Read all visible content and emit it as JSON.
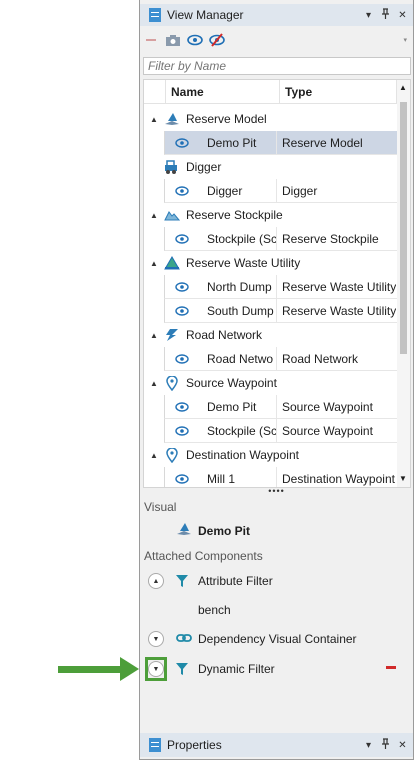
{
  "view_manager": {
    "title": "View Manager",
    "title_buttons": [
      "▾",
      "ᵖ",
      "✕"
    ],
    "filter_placeholder": "Filter by Name",
    "columns": {
      "name": "Name",
      "type": "Type"
    },
    "groups": [
      {
        "label": "Reserve Model",
        "icon": "reserve-model-icon",
        "expanded": true,
        "items": [
          {
            "name": "Demo Pit",
            "type": "Reserve Model",
            "selected": true
          }
        ]
      },
      {
        "label": "Digger",
        "icon": "digger-icon",
        "expanded": false,
        "items": [
          {
            "name": "Digger",
            "type": "Digger"
          }
        ]
      },
      {
        "label": "Reserve Stockpile",
        "icon": "stockpile-icon",
        "expanded": true,
        "items": [
          {
            "name": "Stockpile (Sc",
            "type": "Reserve Stockpile"
          }
        ]
      },
      {
        "label": "Reserve Waste Utility",
        "icon": "waste-utility-icon",
        "expanded": true,
        "items": [
          {
            "name": "North Dump",
            "type": "Reserve Waste Utility"
          },
          {
            "name": "South Dump",
            "type": "Reserve Waste Utility"
          }
        ]
      },
      {
        "label": "Road Network",
        "icon": "road-network-icon",
        "expanded": true,
        "items": [
          {
            "name": "Road Netwo",
            "type": "Road Network"
          }
        ]
      },
      {
        "label": "Source Waypoint",
        "icon": "waypoint-pin-icon",
        "expanded": true,
        "items": [
          {
            "name": "Demo Pit",
            "type": "Source Waypoint"
          },
          {
            "name": "Stockpile (Sc",
            "type": "Source Waypoint"
          }
        ]
      },
      {
        "label": "Destination Waypoint",
        "icon": "waypoint-pin-icon",
        "expanded": true,
        "items": [
          {
            "name": "Mill 1",
            "type": "Destination Waypoint"
          }
        ]
      }
    ]
  },
  "splitter_grip": "••••",
  "details": {
    "visual_label": "Visual",
    "visual_name": "Demo Pit",
    "attached_label": "Attached Components",
    "components": [
      {
        "label": "Attribute Filter",
        "icon": "filter-funnel-icon",
        "toggle": "▲",
        "sub": "bench"
      },
      {
        "label": "Dependency Visual Container",
        "icon": "link-chain-icon",
        "toggle": "▼"
      },
      {
        "label": "Dynamic Filter",
        "icon": "filter-funnel-icon",
        "toggle": "▼"
      }
    ]
  },
  "properties": {
    "title": "Properties",
    "title_buttons": [
      "▾",
      "ᵖ",
      "✕"
    ]
  },
  "colors": {
    "accent": "#3d8fd1",
    "teal": "#1f8aa8",
    "selection": "#cdd6e4",
    "highlight": "#4d9e3a",
    "remove": "#d12a2a"
  }
}
